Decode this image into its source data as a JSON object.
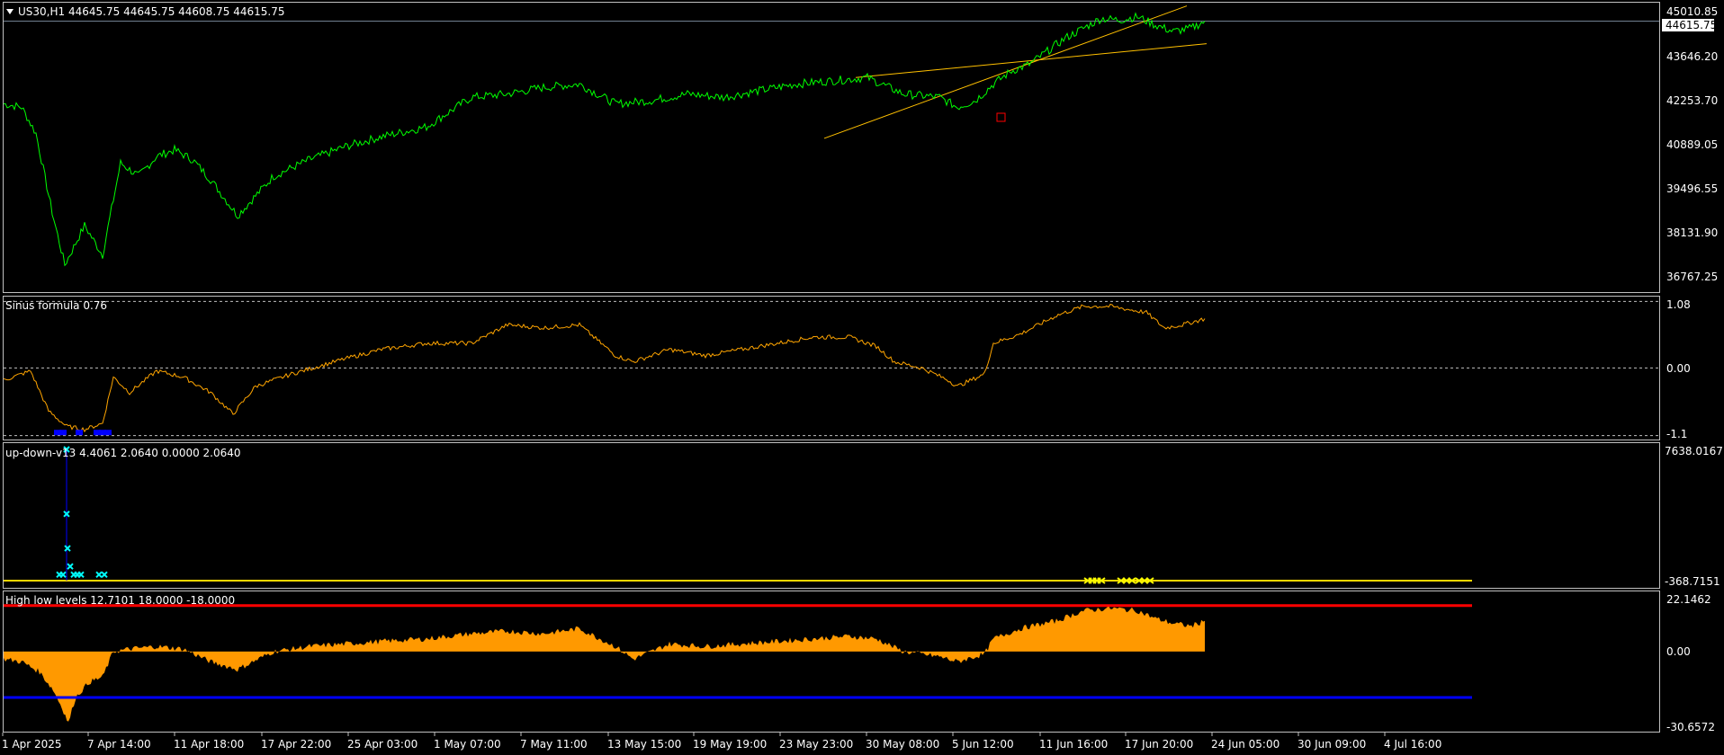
{
  "colors": {
    "background": "#000000",
    "frame": "#c0c0c0",
    "price_line": "#00ff00",
    "oscillator_line": "#ffa500",
    "channel": "#ffc000",
    "high_level": "#ff0000",
    "low_level": "#0000ff",
    "histogram": "#ff9900",
    "marker_cyan": "#00ffff",
    "marker_blue": "#0000ff",
    "marker_yellow": "#ffff00"
  },
  "header": {
    "symbol_label": "US30,H1",
    "ohlc": "44645.75 44645.75 44608.75 44615.75",
    "menu_icon": "triangle-down-icon"
  },
  "price_axis": {
    "current_price": "44615.75",
    "ticks": [
      "45010.85",
      "43646.20",
      "42253.70",
      "40889.05",
      "39496.55",
      "38131.90",
      "36767.25"
    ]
  },
  "time_axis": {
    "labels": [
      "1 Apr 2025",
      "7 Apr 14:00",
      "11 Apr 18:00",
      "17 Apr 22:00",
      "25 Apr 03:00",
      "1 May 07:00",
      "7 May 11:00",
      "13 May 15:00",
      "19 May 19:00",
      "23 May 23:00",
      "30 May 08:00",
      "5 Jun 12:00",
      "11 Jun 16:00",
      "17 Jun 20:00",
      "24 Jun 05:00",
      "30 Jun 09:00",
      "4 Jul 16:00"
    ]
  },
  "indicators": {
    "sinus": {
      "label": "Sinus formula 0.76",
      "ticks": [
        "1.08",
        "0.00",
        "-1.1"
      ]
    },
    "updown": {
      "label": "up-down-v13 4.4061 2.0640 0.0000 2.0640",
      "ticks": [
        "7638.0167",
        "-368.7151"
      ]
    },
    "highlow": {
      "label": "High low levels 12.7101 18.0000 -18.0000",
      "ticks": [
        "22.1462",
        "0.00",
        "-30.6572"
      ]
    }
  },
  "chart_data": [
    {
      "type": "line",
      "name": "US30,H1",
      "x": [
        0,
        20,
        36,
        54,
        68,
        90,
        110,
        130,
        150,
        170,
        190,
        210,
        230,
        260,
        300,
        340,
        380,
        420,
        470,
        520,
        560,
        600,
        640,
        680,
        720,
        760,
        800,
        840,
        880,
        920,
        960,
        1000,
        1040,
        1060,
        1080,
        1100,
        1120,
        1140,
        1160,
        1180,
        1200,
        1220,
        1240,
        1260,
        1280,
        1300,
        1320,
        1335
      ],
      "y": [
        42100,
        42000,
        41200,
        38800,
        37200,
        38400,
        37500,
        40300,
        39900,
        40500,
        40700,
        40400,
        39800,
        38700,
        39900,
        40400,
        40800,
        41100,
        41400,
        42300,
        42400,
        42600,
        42700,
        42100,
        42200,
        42400,
        42300,
        42500,
        42700,
        42800,
        42900,
        42400,
        42300,
        42000,
        42200,
        42700,
        43100,
        43300,
        43700,
        44100,
        44400,
        44700,
        44650,
        44750,
        44500,
        44300,
        44400,
        44620
      ],
      "ylim": [
        36400,
        45150
      ],
      "channel_lines": [
        {
          "x": [
            912,
            1315
          ],
          "y": [
            41050,
            45080
          ]
        },
        {
          "x": [
            947,
            1337
          ],
          "y": [
            42900,
            43930
          ]
        }
      ],
      "current_price_line": 44615.75
    },
    {
      "type": "line",
      "name": "Sinus formula 0.76",
      "x": [
        0,
        30,
        50,
        70,
        90,
        110,
        122,
        140,
        170,
        200,
        230,
        255,
        280,
        320,
        380,
        420,
        470,
        520,
        560,
        600,
        640,
        680,
        700,
        740,
        780,
        820,
        860,
        900,
        940,
        970,
        990,
        1020,
        1050,
        1060,
        1090,
        1100,
        1130,
        1170,
        1200,
        1230,
        1270,
        1290,
        1310,
        1335
      ],
      "y": [
        -0.2,
        -0.05,
        -0.7,
        -0.95,
        -1.0,
        -0.9,
        -0.15,
        -0.4,
        -0.05,
        -0.15,
        -0.4,
        -0.75,
        -0.3,
        -0.1,
        0.15,
        0.3,
        0.4,
        0.4,
        0.7,
        0.65,
        0.7,
        0.2,
        0.1,
        0.3,
        0.2,
        0.3,
        0.4,
        0.5,
        0.5,
        0.35,
        0.1,
        0.0,
        -0.2,
        -0.3,
        -0.1,
        0.4,
        0.55,
        0.85,
        1.0,
        1.0,
        0.9,
        0.65,
        0.7,
        0.8
      ],
      "ylim": [
        -1.12,
        1.1
      ],
      "levels": [
        1.08,
        0.0,
        -1.1
      ],
      "markers_blue_x": [
        60,
        66,
        84,
        104,
        110,
        116
      ]
    },
    {
      "type": "scatter",
      "name": "up-down-v13",
      "ylim": [
        -368.7151,
        7638.0167
      ],
      "baseline": -368.7151,
      "spike_x": 70,
      "spike_top": 7638.0167,
      "cyan_points": [
        {
          "x": 70,
          "y": 7638.0
        },
        {
          "x": 70,
          "y": 3700
        },
        {
          "x": 71,
          "y": 1600
        },
        {
          "x": 74,
          "y": 500
        },
        {
          "x": 62,
          "y": 0
        },
        {
          "x": 66,
          "y": 0
        },
        {
          "x": 78,
          "y": 0
        },
        {
          "x": 82,
          "y": 0
        },
        {
          "x": 86,
          "y": 0
        },
        {
          "x": 106,
          "y": 0
        },
        {
          "x": 112,
          "y": 0
        }
      ],
      "yellow_x": [
        1205,
        1210,
        1215,
        1220,
        1242,
        1248,
        1254,
        1262,
        1268,
        1274
      ]
    },
    {
      "type": "area",
      "name": "High low levels",
      "ylim": [
        -30.6572,
        22.1462
      ],
      "upper_level": 18.0,
      "lower_level": -18.0,
      "x": [
        0,
        20,
        40,
        55,
        65,
        72,
        80,
        95,
        110,
        122,
        140,
        170,
        200,
        230,
        260,
        300,
        340,
        380,
        420,
        470,
        520,
        560,
        600,
        640,
        680,
        700,
        740,
        780,
        820,
        860,
        900,
        940,
        970,
        1000,
        1040,
        1060,
        1090,
        1100,
        1130,
        1170,
        1200,
        1230,
        1260,
        1280,
        1300,
        1320,
        1335
      ],
      "y": [
        -3,
        -4,
        -8,
        -15,
        -22,
        -28,
        -18,
        -12,
        -10,
        0,
        1,
        2,
        1,
        -4,
        -7,
        0,
        2,
        3,
        4,
        5,
        7,
        8,
        7,
        9,
        2,
        -3,
        3,
        2,
        3,
        4,
        5,
        6,
        5,
        0,
        -2,
        -4,
        -1,
        5,
        9,
        12,
        16,
        17,
        16,
        13,
        11,
        10,
        12
      ]
    }
  ]
}
